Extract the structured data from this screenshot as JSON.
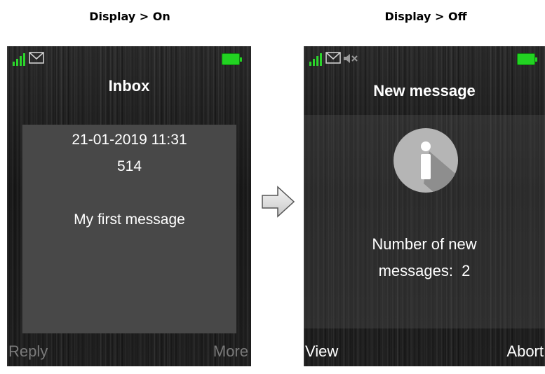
{
  "captions": {
    "left": "Display > On",
    "right": "Display > Off"
  },
  "left_screen": {
    "title": "Inbox",
    "datetime": "21-01-2019 11:31",
    "sender": "514",
    "message": "My first message",
    "softkey_left": "Reply",
    "softkey_right": "More"
  },
  "right_screen": {
    "title": "New message",
    "body_line1": "Number of new",
    "body_line2": "messages:  2",
    "softkey_left": "View",
    "softkey_right": "Abort"
  },
  "status_icons": [
    "signal-icon",
    "envelope-icon",
    "mute-icon",
    "battery-icon"
  ],
  "colors": {
    "signal_green": "#2bd62b",
    "battery_green": "#22d322",
    "panel_gray": "#484848",
    "softkey_inactive": "#7a7a7a",
    "softkey_active": "#ffffff"
  }
}
